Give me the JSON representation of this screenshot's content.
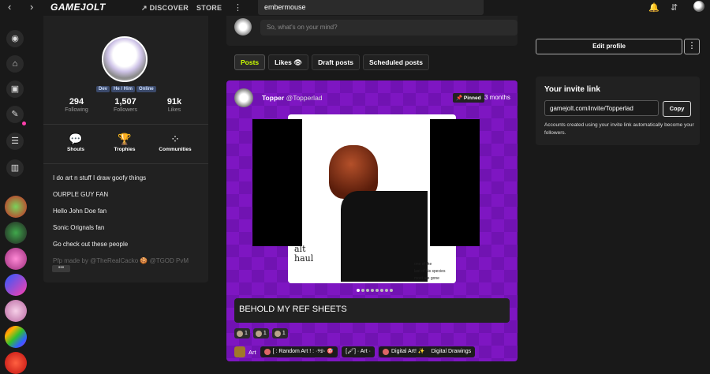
{
  "topbar": {
    "back_icon": "chevron-left-icon",
    "forward_icon": "chevron-right-icon",
    "logo": "GAMEJOLT",
    "discover": "DISCOVER",
    "store": "STORE",
    "search_value": "embermouse"
  },
  "profile": {
    "tags": [
      "Dev",
      "He / Him",
      "Online"
    ],
    "stats": [
      {
        "value": "294",
        "label": "Following"
      },
      {
        "value": "1,507",
        "label": "Followers"
      },
      {
        "value": "91k",
        "label": "Likes"
      }
    ],
    "buttons": [
      "Shouts",
      "Trophies",
      "Communities"
    ],
    "bio": [
      "I do art n stuff I draw goofy things",
      "OURPLE GUY FAN",
      "Hello John Doe fan",
      "Sonic Orignals fan",
      "Go check out these people",
      "Pfp made by @TheRealCacko 🍪 @TGOD PvM"
    ],
    "more": "•••"
  },
  "composer": {
    "placeholder": "So, what's on your mind?"
  },
  "tabs": [
    "Posts",
    "Likes",
    "Draft posts",
    "Scheduled posts"
  ],
  "post": {
    "author": "Topper",
    "handle": "@Topperlad",
    "pinned": "Pinned",
    "time": "3 months",
    "hand_text_1": "alt",
    "hand_text_2": "haul",
    "media_caption": "one of the\nlast of his species\nmost are gone",
    "text": "BEHOLD MY REF SHEETS",
    "reactions": [
      {
        "count": "1"
      },
      {
        "count": "1"
      },
      {
        "count": "1"
      }
    ],
    "community": "Art",
    "channels": [
      "[ : Random Art ! : ·୨୭· 🎯",
      "[🖌] · Art ·",
      "Digital Art! ✨",
      "Digital Drawings"
    ]
  },
  "sidebar_right": {
    "edit_profile": "Edit profile",
    "invite_title": "Your invite link",
    "invite_url": "gamejolt.com/invite/Topperlad",
    "copy": "Copy",
    "invite_desc": "Accounts created using your invite link automatically become your followers."
  },
  "colors": {
    "accent": "#ccff00",
    "post_bg": "#7e16c2",
    "card_bg": "#212121",
    "page_bg": "#191919"
  }
}
